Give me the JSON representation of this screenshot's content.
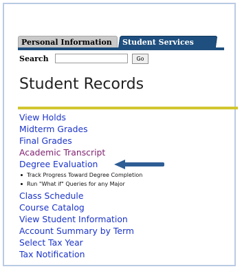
{
  "tabs": [
    {
      "label": "Personal Information"
    },
    {
      "label": "Student Services"
    }
  ],
  "search": {
    "label": "Search",
    "value": "",
    "go_label": "Go"
  },
  "page_title": "Student Records",
  "menu": {
    "before": [
      "View Holds",
      "Midterm Grades",
      "Final Grades",
      "Academic Transcript",
      "Degree Evaluation"
    ],
    "bullets": [
      "Track Progress Toward Degree Completion",
      "Run \"What if\" Queries for any Major"
    ],
    "after": [
      "Class Schedule",
      "Course Catalog",
      "View Student Information",
      "Account Summary by Term",
      "Select Tax Year",
      "Tax Notification"
    ]
  },
  "colors": {
    "tab_active": "#1f4f7f",
    "link": "#1b34c8",
    "visited_link": "#7e1f6f",
    "rule": "#d1c62f",
    "arrow": "#2e5d95"
  },
  "icons": {
    "pointer": "left-arrow-icon"
  }
}
